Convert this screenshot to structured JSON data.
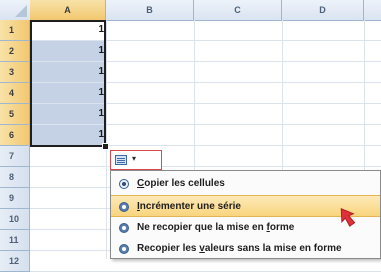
{
  "columns": [
    {
      "label": "A",
      "selected": true
    },
    {
      "label": "B",
      "selected": false
    },
    {
      "label": "C",
      "selected": false
    },
    {
      "label": "D",
      "selected": false
    }
  ],
  "rows": [
    {
      "label": "1",
      "selected": true,
      "value": "1"
    },
    {
      "label": "2",
      "selected": true,
      "value": "1"
    },
    {
      "label": "3",
      "selected": true,
      "value": "1"
    },
    {
      "label": "4",
      "selected": true,
      "value": "1"
    },
    {
      "label": "5",
      "selected": true,
      "value": "1"
    },
    {
      "label": "6",
      "selected": true,
      "value": "1"
    },
    {
      "label": "7",
      "selected": false,
      "value": ""
    },
    {
      "label": "8",
      "selected": false,
      "value": ""
    },
    {
      "label": "9",
      "selected": false,
      "value": ""
    },
    {
      "label": "10",
      "selected": false,
      "value": ""
    },
    {
      "label": "11",
      "selected": false,
      "value": ""
    },
    {
      "label": "12",
      "selected": false,
      "value": ""
    }
  ],
  "autofill_button": {
    "icon": "autofill-options-icon",
    "arrow": "▾"
  },
  "menu": {
    "items": [
      {
        "underline": "C",
        "rest": "opier les cellules",
        "checked": true,
        "hover": false
      },
      {
        "underline": "I",
        "rest": "ncrémenter une série",
        "checked": false,
        "hover": true
      },
      {
        "prefix": "Ne recopier que la mise en ",
        "underline": "f",
        "rest": "orme",
        "checked": false,
        "hover": false
      },
      {
        "prefix": "Recopier les ",
        "underline": "v",
        "rest": "aleurs sans la mise en forme",
        "checked": false,
        "hover": false
      }
    ]
  },
  "colors": {
    "selection": "#c5d2e6",
    "header_selected": "#f2c870",
    "menu_hover": "#f8d57c",
    "cursor": "#e0313a"
  }
}
